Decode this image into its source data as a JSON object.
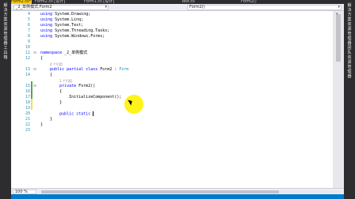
{
  "left_panel": {
    "label": "解决方案资源管理器 工具箱"
  },
  "right_panel": {
    "label": "解决方案资源管理器 团队资源管理器"
  },
  "tabs": [
    {
      "label": "Form2.cs*",
      "active": true
    },
    {
      "label": "Form2.cs [设计]",
      "active": false
    },
    {
      "label": "Form1.cs [设计]",
      "active": false
    },
    {
      "label": "Test.cs",
      "active": false
    },
    {
      "label": "Form2()",
      "active": false
    }
  ],
  "nav": {
    "left": "_2_单例模式.Form2",
    "right": "Form2()"
  },
  "code": [
    {
      "n": "4",
      "text": "using System.Drawing;"
    },
    {
      "n": "5",
      "text": "using System.Linq;"
    },
    {
      "n": "6",
      "text": "using System.Text;"
    },
    {
      "n": "7",
      "text": "using System.Threading.Tasks;"
    },
    {
      "n": "8",
      "text": "using System.Windows.Forms;"
    },
    {
      "n": "9",
      "text": ""
    },
    {
      "n": "10",
      "text": ""
    },
    {
      "n": "11",
      "text": "namespace _2_单例模式"
    },
    {
      "n": "12",
      "text": "{"
    },
    {
      "n": "",
      "text": "4 个引用"
    },
    {
      "n": "13",
      "text": "    public partial class Form2 : Form"
    },
    {
      "n": "14",
      "text": "    {"
    },
    {
      "n": "",
      "text": "1 个引用"
    },
    {
      "n": "15",
      "text": "        private Form2()"
    },
    {
      "n": "16",
      "text": "        {"
    },
    {
      "n": "17",
      "text": "            InitializeComponent();"
    },
    {
      "n": "18",
      "text": "        }"
    },
    {
      "n": "19",
      "text": ""
    },
    {
      "n": "20",
      "text": "        public static |"
    },
    {
      "n": "21",
      "text": "    }"
    },
    {
      "n": "22",
      "text": "}"
    },
    {
      "n": "23",
      "text": ""
    }
  ],
  "zoom": "100 %",
  "colors": {
    "tab_active": "#ffcc00",
    "status_bar": "#007acc",
    "keyword": "#0000ff",
    "class": "#2b91af"
  }
}
